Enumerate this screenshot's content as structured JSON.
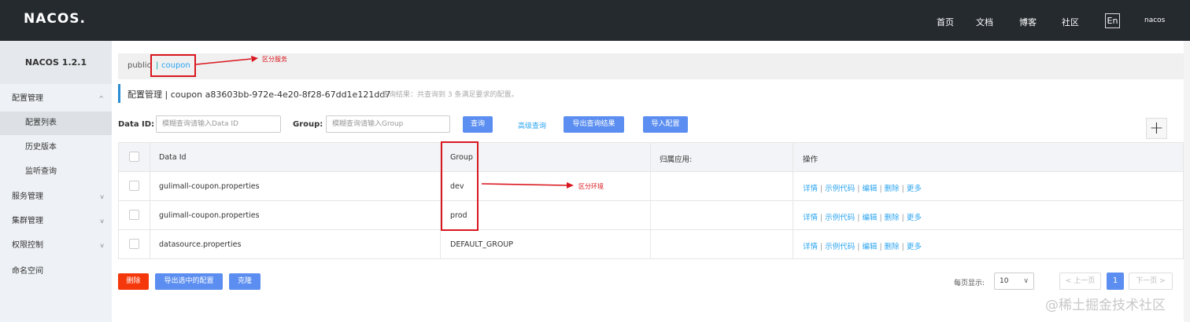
{
  "header": {
    "logo": "NACOS.",
    "nav": [
      "首页",
      "文档",
      "博客",
      "社区"
    ],
    "lang": "En",
    "user": "nacos"
  },
  "sidebar": {
    "version": "NACOS 1.2.1",
    "items": [
      {
        "label": "配置管理",
        "level": 1,
        "chevron": "^"
      },
      {
        "label": "配置列表",
        "level": 2
      },
      {
        "label": "历史版本",
        "level": 2
      },
      {
        "label": "监听查询",
        "level": 2
      },
      {
        "label": "服务管理",
        "level": 1,
        "chevron": "v"
      },
      {
        "label": "集群管理",
        "level": 1,
        "chevron": "v"
      },
      {
        "label": "权限控制",
        "level": 1,
        "chevron": "v"
      },
      {
        "label": "命名空间",
        "level": 1
      }
    ]
  },
  "breadcrumb": {
    "public": "public",
    "sep": "|",
    "active": "coupon",
    "annotation": "区分服务"
  },
  "title": {
    "main": "配置管理  |  coupon  a83603bb-972e-4e20-8f28-67dd1e121dd7",
    "sub": "查询结果：共查询到 3 条满足要求的配置。"
  },
  "filters": {
    "dataid_label": "Data ID:",
    "dataid_placeholder": "模糊查询请输入Data ID",
    "group_label": "Group:",
    "group_placeholder": "模糊查询请输入Group",
    "search_btn": "查询",
    "advanced": "高级查询",
    "export_btn": "导出查询结果",
    "import_btn": "导入配置",
    "plus": "+"
  },
  "table": {
    "headers": [
      "Data Id",
      "Group",
      "归属应用:",
      "操作"
    ],
    "rows": [
      {
        "dataid": "gulimall-coupon.properties",
        "group": "dev",
        "app": ""
      },
      {
        "dataid": "gulimall-coupon.properties",
        "group": "prod",
        "app": ""
      },
      {
        "dataid": "datasource.properties",
        "group": "DEFAULT_GROUP",
        "app": ""
      }
    ],
    "ops": [
      "详情",
      "示例代码",
      "编辑",
      "删除",
      "更多"
    ],
    "op_sep": "|",
    "annotation": "区分环境"
  },
  "footer": {
    "delete_btn": "删除",
    "export_selected_btn": "导出选中的配置",
    "clone_btn": "克隆",
    "page_size_label": "每页显示:",
    "page_size": "10",
    "dropdown_glyph": "∨",
    "prev": "< 上一页",
    "current_page": "1",
    "next": "下一页 >",
    "watermark": "@稀土掘金技术社区"
  },
  "colors": {
    "topbar": "#252a2f",
    "accent_blue": "#5b8ef0",
    "link": "#2aa4f0",
    "danger": "#f5380c",
    "annotation_red": "#d9171e"
  }
}
